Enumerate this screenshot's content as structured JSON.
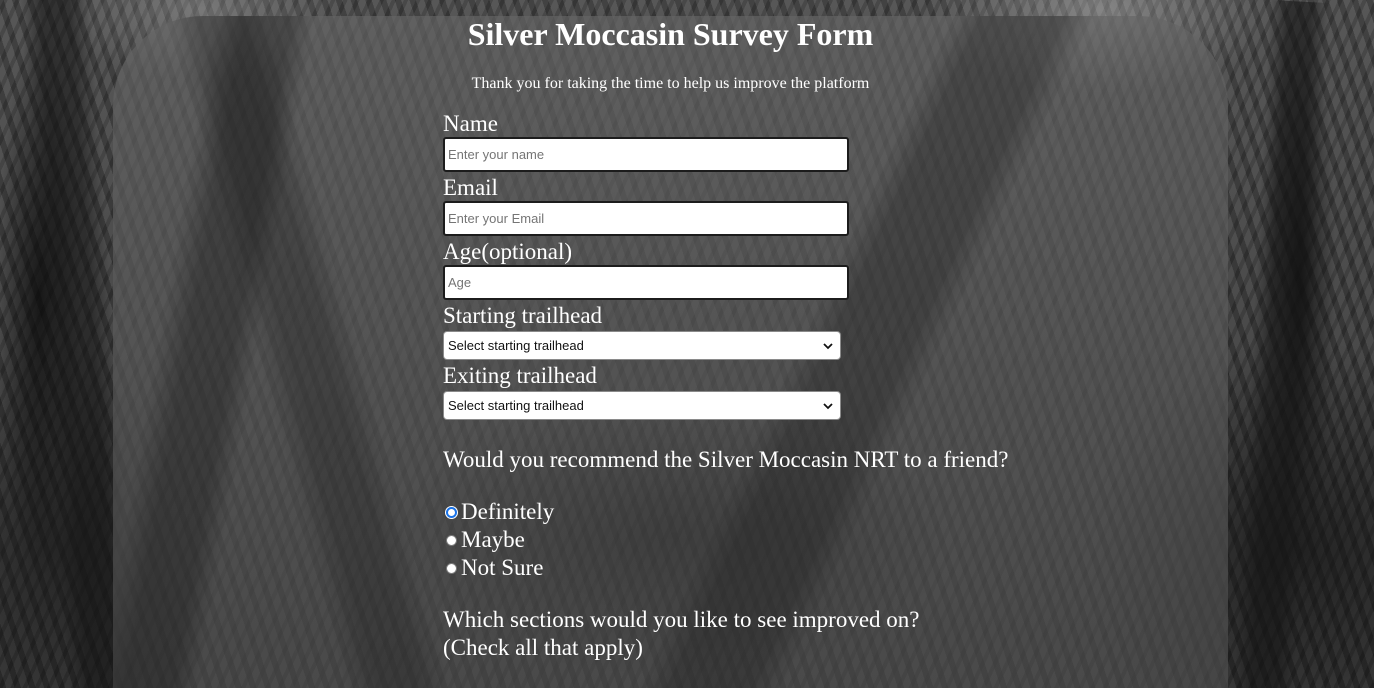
{
  "header": {
    "title": "Silver Moccasin Survey Form",
    "subtitle": "Thank you for taking the time to help us improve the platform"
  },
  "form": {
    "name": {
      "label": "Name",
      "placeholder": "Enter your name",
      "value": ""
    },
    "email": {
      "label": "Email",
      "placeholder": "Enter your Email",
      "value": ""
    },
    "age": {
      "label": "Age(optional)",
      "placeholder": "Age",
      "value": ""
    },
    "starting_trailhead": {
      "label": "Starting trailhead",
      "selected": "Select starting trailhead"
    },
    "exiting_trailhead": {
      "label": "Exiting trailhead",
      "selected": "Select starting trailhead"
    },
    "recommend": {
      "question": "Would you recommend the Silver Moccasin NRT to a friend?",
      "options": [
        {
          "label": "Definitely",
          "checked": true
        },
        {
          "label": "Maybe",
          "checked": false
        },
        {
          "label": "Not Sure",
          "checked": false
        }
      ]
    },
    "improve": {
      "question_line1": "Which sections would you like to see improved on?",
      "question_line2": "(Check all that apply)"
    }
  },
  "icons": {
    "select_arrow": "chevron-down-icon",
    "radio_selected": "radio-selected",
    "radio_unselected": "radio-unselected"
  },
  "colors": {
    "panel": "#5a5a5a",
    "text": "#ffffff",
    "radio_accent": "#1a73e8"
  }
}
